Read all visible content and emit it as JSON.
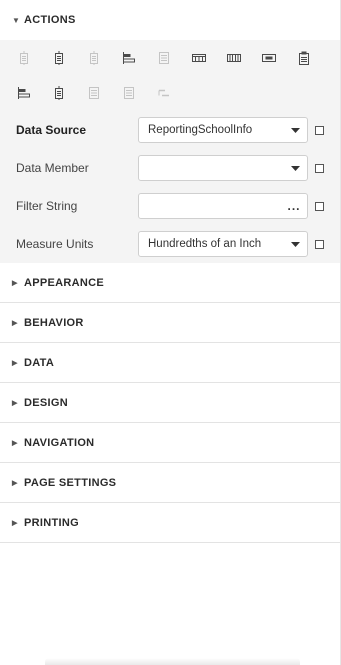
{
  "actions": {
    "title": "ACTIONS",
    "toolbar_row1": [
      {
        "icon": "align-left-icon",
        "enabled": false
      },
      {
        "icon": "align-center-icon",
        "enabled": true
      },
      {
        "icon": "align-right-icon",
        "enabled": false
      },
      {
        "icon": "align-to-grid-icon",
        "enabled": true
      },
      {
        "icon": "size-to-grid-icon",
        "enabled": false
      },
      {
        "icon": "horizontal-spacing-equal-icon",
        "enabled": true
      },
      {
        "icon": "horizontal-spacing-increase-icon",
        "enabled": true
      },
      {
        "icon": "horizontal-spacing-decrease-icon",
        "enabled": true
      },
      {
        "icon": "clipboard-icon",
        "enabled": true
      }
    ],
    "toolbar_row2": [
      {
        "icon": "align-lefts-icon",
        "enabled": true
      },
      {
        "icon": "center-horizontally-icon",
        "enabled": true
      },
      {
        "icon": "vertical-spacing-icon",
        "enabled": false
      },
      {
        "icon": "same-size-icon",
        "enabled": false
      },
      {
        "icon": "bring-front-icon",
        "enabled": false
      }
    ],
    "properties": {
      "data_source": {
        "label": "Data Source",
        "value": "ReportingSchoolInfo"
      },
      "data_member": {
        "label": "Data Member",
        "value": ""
      },
      "filter_string": {
        "label": "Filter String",
        "value": "",
        "button": "..."
      },
      "measure_units": {
        "label": "Measure Units",
        "value": "Hundredths of an Inch"
      }
    }
  },
  "sections": [
    {
      "title": "APPEARANCE"
    },
    {
      "title": "BEHAVIOR"
    },
    {
      "title": "DATA"
    },
    {
      "title": "DESIGN"
    },
    {
      "title": "NAVIGATION"
    },
    {
      "title": "PAGE SETTINGS"
    },
    {
      "title": "PRINTING"
    }
  ],
  "colors": {
    "icon_enabled": "#4a4a4a",
    "icon_disabled": "#c4c4c4",
    "actions_bg": "#f4f4f4"
  }
}
